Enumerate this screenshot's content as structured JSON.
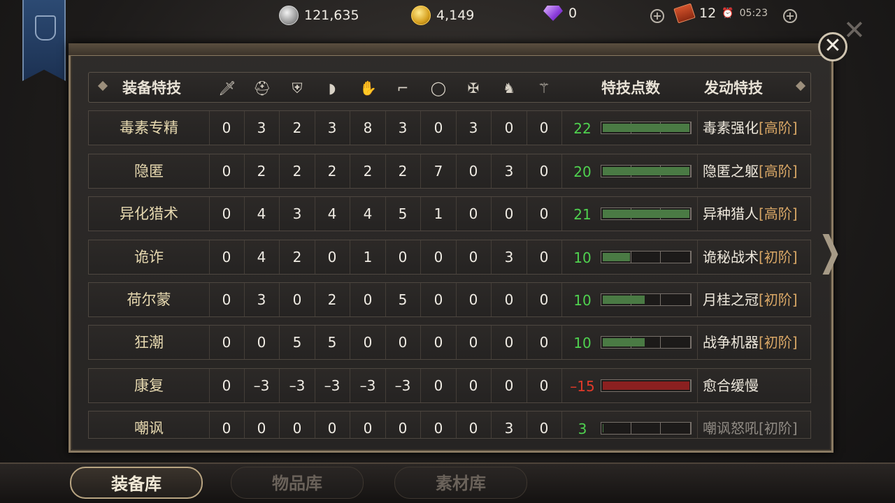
{
  "resources": {
    "silver": "121,635",
    "gold": "4,149",
    "gems": "0",
    "tickets": "12",
    "timer": "05:23"
  },
  "table": {
    "header": {
      "skill_col": "装备特技",
      "points_col": "特技点数",
      "active_col": "发动特技"
    },
    "slot_icons": [
      "weapon-icon",
      "helmet-icon",
      "chest-icon",
      "shoulder-icon",
      "gloves-icon",
      "boots-icon",
      "ring-icon",
      "charm-icon",
      "horse-icon",
      "relic-icon"
    ],
    "rows": [
      {
        "name": "毒素专精",
        "values": [
          "0",
          "3",
          "2",
          "3",
          "8",
          "3",
          "0",
          "3",
          "0",
          "0"
        ],
        "points": "22",
        "points_color": "#4fd14f",
        "fill": 1.0,
        "skill": "毒素强化",
        "tier": "[高阶]",
        "dim": false
      },
      {
        "name": "隐匿",
        "values": [
          "0",
          "2",
          "2",
          "2",
          "2",
          "2",
          "7",
          "0",
          "3",
          "0"
        ],
        "points": "20",
        "points_color": "#4fd14f",
        "fill": 1.0,
        "skill": "隐匿之躯",
        "tier": "[高阶]",
        "dim": false
      },
      {
        "name": "异化猎术",
        "values": [
          "0",
          "4",
          "3",
          "4",
          "4",
          "5",
          "1",
          "0",
          "0",
          "0"
        ],
        "points": "21",
        "points_color": "#4fd14f",
        "fill": 1.0,
        "skill": "异种猎人",
        "tier": "[高阶]",
        "dim": false
      },
      {
        "name": "诡诈",
        "values": [
          "0",
          "4",
          "2",
          "0",
          "1",
          "0",
          "0",
          "0",
          "3",
          "0"
        ],
        "points": "10",
        "points_color": "#4fd14f",
        "fill": 0.333,
        "skill": "诡秘战术",
        "tier": "[初阶]",
        "dim": false
      },
      {
        "name": "荷尔蒙",
        "values": [
          "0",
          "3",
          "0",
          "2",
          "0",
          "5",
          "0",
          "0",
          "0",
          "0"
        ],
        "points": "10",
        "points_color": "#4fd14f",
        "fill": 0.5,
        "skill": "月桂之冠",
        "tier": "[初阶]",
        "dim": false
      },
      {
        "name": "狂潮",
        "values": [
          "0",
          "0",
          "5",
          "5",
          "0",
          "0",
          "0",
          "0",
          "0",
          "0"
        ],
        "points": "10",
        "points_color": "#4fd14f",
        "fill": 0.5,
        "skill": "战争机器",
        "tier": "[初阶]",
        "dim": false
      },
      {
        "name": "康复",
        "values": [
          "0",
          "–3",
          "–3",
          "–3",
          "–3",
          "–3",
          "0",
          "0",
          "0",
          "0"
        ],
        "points": "–15",
        "points_color": "#e03a2a",
        "fill": -1.0,
        "skill": "愈合缓慢",
        "tier": "",
        "dim": false
      },
      {
        "name": "嘲讽",
        "values": [
          "0",
          "0",
          "0",
          "0",
          "0",
          "0",
          "0",
          "0",
          "3",
          "0"
        ],
        "points": "3",
        "points_color": "#4fd14f",
        "fill": 0.033,
        "skill": "嘲讽怒吼",
        "tier": "[初阶]",
        "dim": true
      }
    ]
  },
  "tabs": {
    "equipment": "装备库",
    "items": "物品库",
    "materials": "素材库"
  }
}
